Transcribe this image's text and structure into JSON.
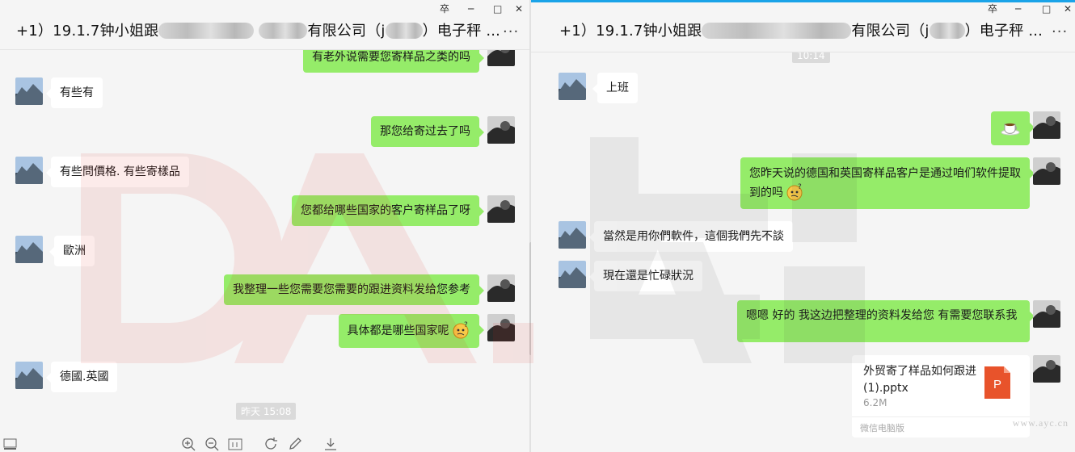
{
  "colors": {
    "accent": "#1aa3e8",
    "bubble_out": "#95ec69",
    "bubble_in": "#ffffff",
    "background": "#f5f5f5",
    "file_icon": "#e8532b"
  },
  "left": {
    "window_controls": [
      "卒",
      "─",
      "□",
      "✕"
    ],
    "title": {
      "p1": "+1）19.1.7钟小姐跟",
      "p2": "有限公司（j",
      "p3": "）电子秤 ..."
    },
    "more_label": "...",
    "messages": {
      "m0": "有老外说需要您寄样品之类的吗",
      "m1": "有些有",
      "m2": "那您给寄过去了吗",
      "m3": "有些問價格. 有些寄樣品",
      "m4": "您都给哪些国家的客户寄样品了呀",
      "m5": "歐洲",
      "m6": "我整理一些您需要您需要的跟进资料发给您参考",
      "m7": "具体都是哪些国家呢",
      "m8": "德國.英國"
    },
    "timestamp": "昨天 15:08",
    "toolbar_icons": [
      "zoom-in-icon",
      "zoom-out-icon",
      "actual-size-icon",
      "rotate-icon",
      "edit-icon",
      "download-icon"
    ]
  },
  "right": {
    "window_controls": [
      "卒",
      "─",
      "□",
      "✕"
    ],
    "title": {
      "p1": "+1）19.1.7钟小姐跟",
      "p2": "有限公司（j",
      "p3": "）电子秤 ..."
    },
    "more_label": "...",
    "timestamp": "10:14",
    "messages": {
      "r1": "上班",
      "r3": "您昨天说的德国和英国寄样品客户是通过咱们软件提取到的吗",
      "r4": "當然是用你們軟件，這個我們先不談",
      "r5": "現在還是忙碌狀況",
      "r6": "嗯嗯  好的    我这边把整理的资料发给您    有需要您联系我"
    },
    "file": {
      "name": "外贸寄了样品如何跟进(1).pptx",
      "size": "6.2M",
      "footer": "微信电脑版",
      "icon_letter": "P"
    }
  },
  "watermark": {
    "site": "www.ayc.cn"
  }
}
